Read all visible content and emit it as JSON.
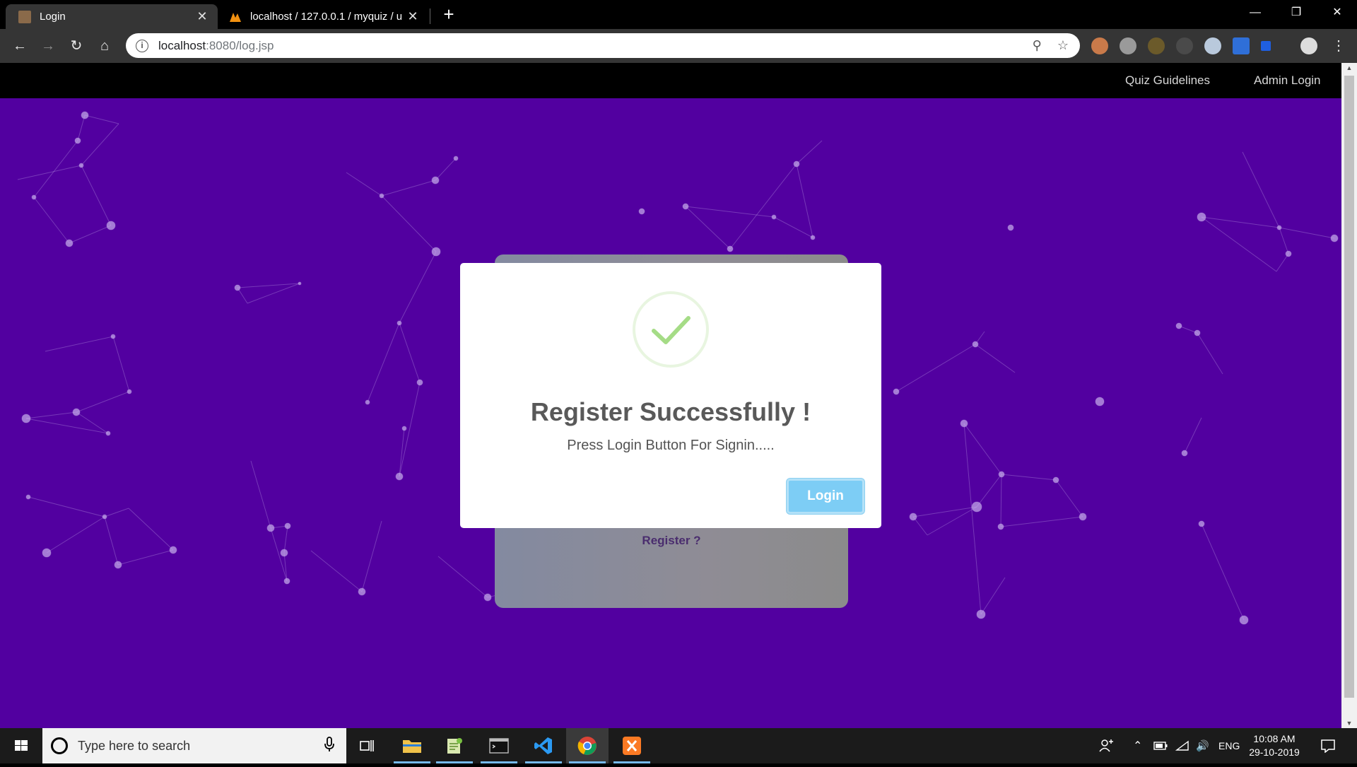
{
  "browser": {
    "tabs": [
      {
        "title": "Login",
        "active": true
      },
      {
        "title": "localhost / 127.0.0.1 / myquiz / u",
        "active": false
      }
    ],
    "new_tab_label": "+",
    "url_host": "localhost",
    "url_rest": ":8080/log.jsp"
  },
  "site_nav": {
    "links": [
      "Quiz Guidelines",
      "Admin Login"
    ]
  },
  "login_card": {
    "register_link": "Register ?"
  },
  "modal": {
    "title": "Register Successfully !",
    "message": "Press Login Button For Signin.....",
    "button": "Login",
    "accent_color": "#a5dc86"
  },
  "taskbar": {
    "search_placeholder": "Type here to search",
    "language": "ENG",
    "time": "10:08 AM",
    "date": "29-10-2019"
  },
  "colors": {
    "page_background": "#5200a0",
    "button": "#7dcdf5"
  }
}
